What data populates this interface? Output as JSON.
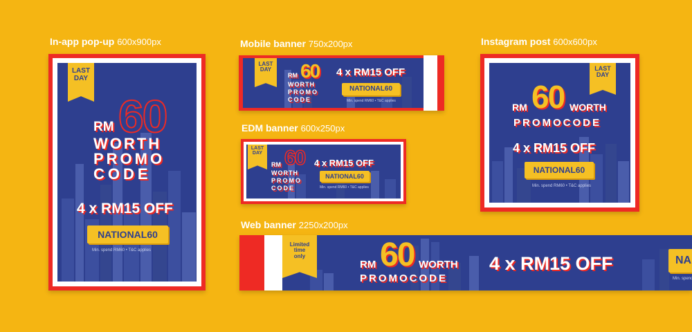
{
  "captions": {
    "popup": {
      "title": "In-app pop-up",
      "size": "600x900px"
    },
    "mobile": {
      "title": "Mobile banner",
      "size": "750x200px"
    },
    "instagram": {
      "title": "Instagram post",
      "size": "600x600px"
    },
    "edm": {
      "title": "EDM banner",
      "size": "600x250px"
    },
    "web": {
      "title": "Web banner",
      "size": "2250x200px"
    }
  },
  "promo": {
    "ribbon_last": "LAST",
    "ribbon_day": "DAY",
    "ribbon_limited": "Limited",
    "ribbon_time": "time",
    "ribbon_only": "only",
    "rm": "RM",
    "sixty": "60",
    "worth": "WORTH",
    "promo": "PROMO",
    "code": "CODE",
    "promocode": "PROMOCODE",
    "offer": "4 x RM15 OFF",
    "code_value": "NATIONAL60",
    "code_partial": "NA",
    "terms": "Min. spend RM60 • T&C applies",
    "terms_short": "Min. spend RM60 • T&C applies"
  },
  "colors": {
    "background": "#f5b512",
    "navy": "#2e3f8f",
    "yellow": "#f5c024",
    "red": "#ee2a24",
    "white": "#ffffff"
  }
}
